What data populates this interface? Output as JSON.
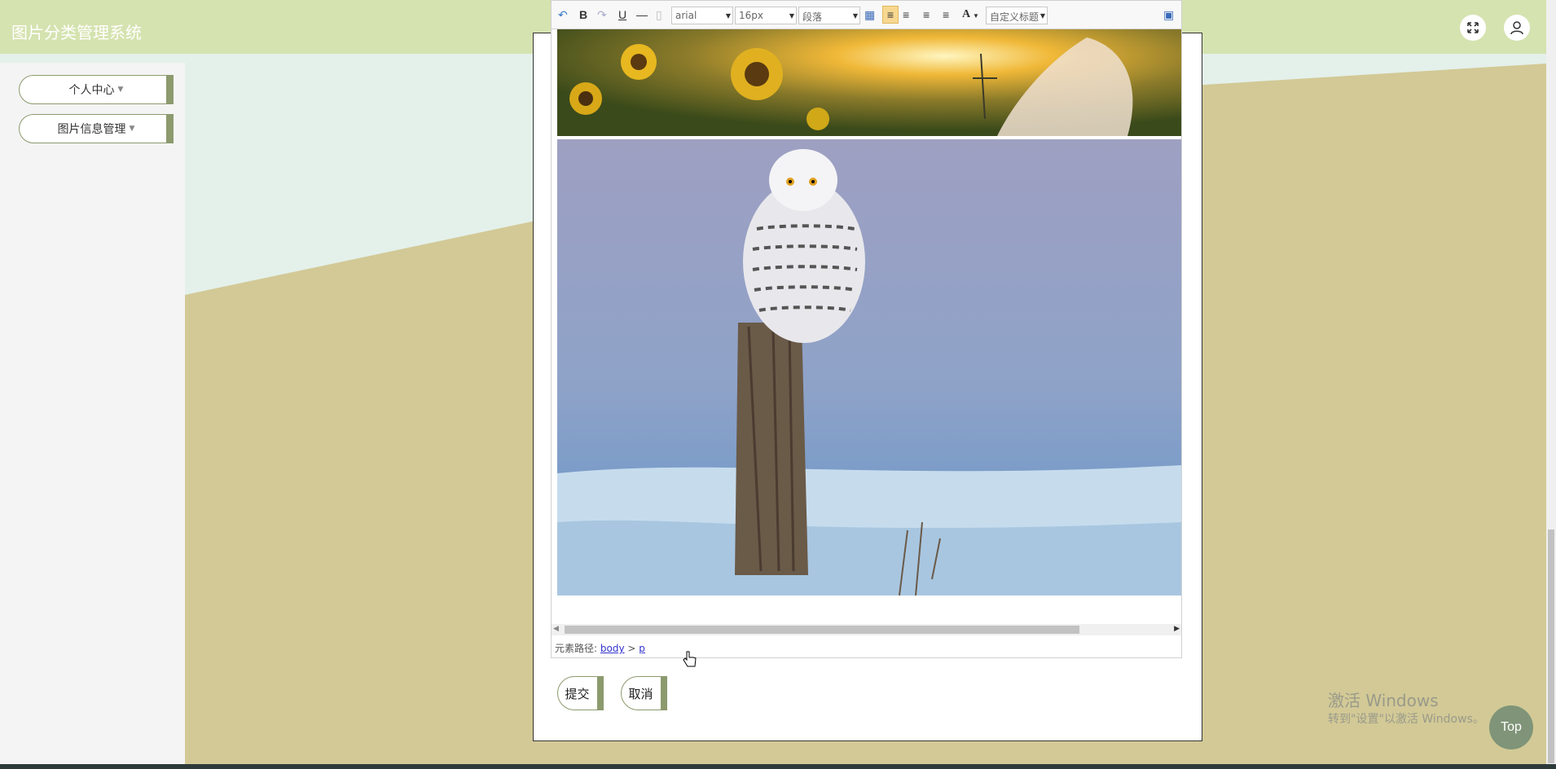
{
  "app": {
    "title": "图片分类管理系统"
  },
  "colors": {
    "header": "#d5e3b0",
    "accent": "#8c9a6e",
    "top_button": "#7f9478"
  },
  "sidebar": {
    "items": [
      {
        "label": "个人中心"
      },
      {
        "label": "图片信息管理"
      }
    ]
  },
  "toolbar": {
    "font_family": "arial",
    "font_size": "16px",
    "paragraph": "段落",
    "custom_heading": "自定义标题",
    "bold": "B",
    "underline": "U",
    "font_color": "A"
  },
  "editor": {
    "element_path_label": "元素路径:",
    "path": [
      "body",
      "p"
    ],
    "path_separator": ">"
  },
  "actions": {
    "submit": "提交",
    "cancel": "取消"
  },
  "watermark": {
    "line1": "激活 Windows",
    "line2": "转到\"设置\"以激活 Windows。"
  },
  "back_to_top": "Top"
}
